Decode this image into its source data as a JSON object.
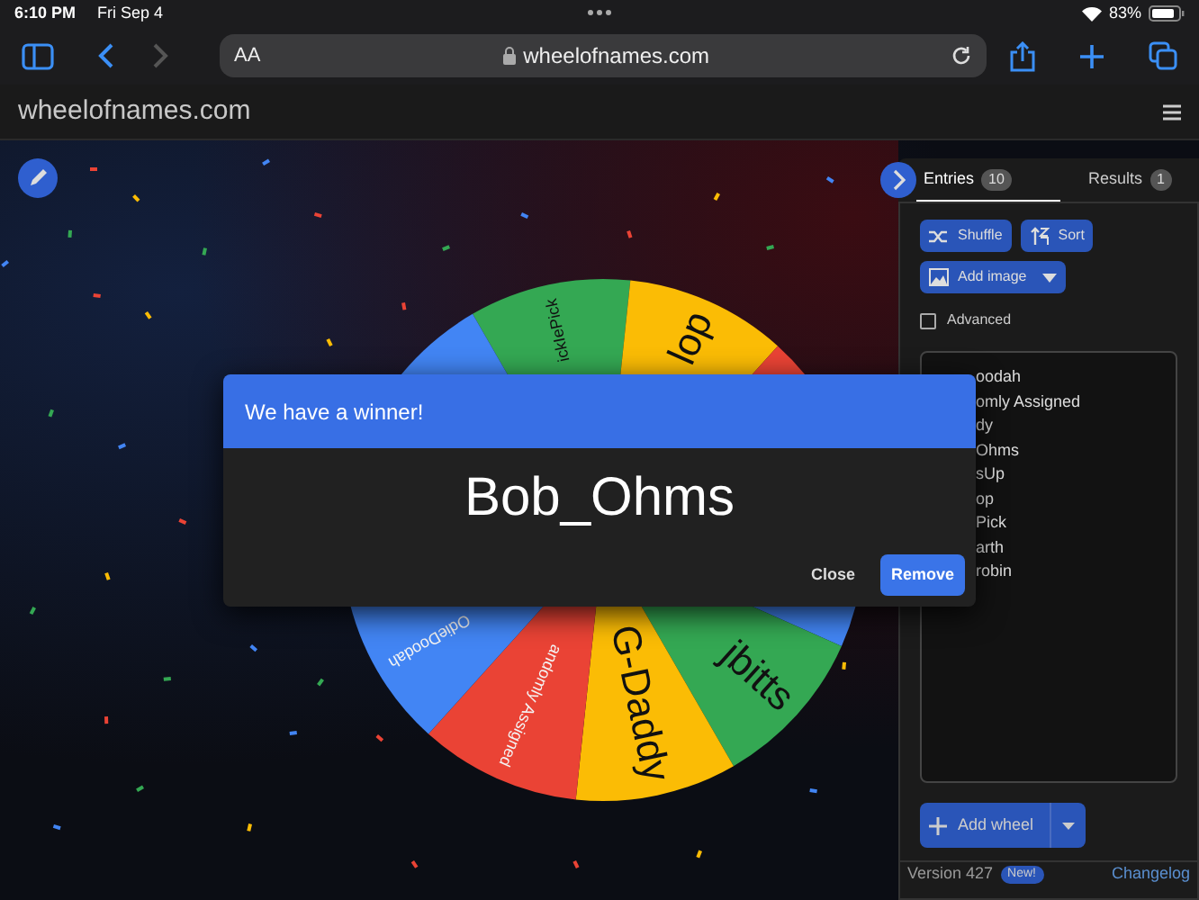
{
  "status_bar": {
    "time": "6:10 PM",
    "date": "Fri Sep 4",
    "battery": "83%"
  },
  "browser": {
    "text_size": "AA",
    "url": "wheelofnames.com"
  },
  "site_header": {
    "title": "wheelofnames.com"
  },
  "wheel": {
    "segments": [
      {
        "color": "#34a853",
        "label": "ickIePick"
      },
      {
        "color": "#fbbc05",
        "label": "lop"
      },
      {
        "color": "#ea4335"
      },
      {
        "color": "#4285f4"
      },
      {
        "color": "#34a853",
        "label": "jbitts"
      },
      {
        "color": "#fbbc05",
        "label": "G-Daddy"
      },
      {
        "color": "#ea4335",
        "label": "andomly Assigned"
      },
      {
        "color": "#4285f4",
        "label": "OdieDoodah"
      },
      {
        "color": "#4285f4"
      }
    ]
  },
  "dialog": {
    "title": "We have a winner!",
    "winner": "Bob_Ohms",
    "buttons": [
      {
        "label": "Close",
        "kind": "text"
      },
      {
        "label": "Remove",
        "kind": "primary"
      }
    ]
  },
  "panel": {
    "tabs": [
      {
        "label": "Entries",
        "count": "10",
        "selected": true
      },
      {
        "label": "Results",
        "count": "1",
        "selected": false
      }
    ],
    "buttons": [
      {
        "label": "Shuffle",
        "kind": "shuffle"
      },
      {
        "label": "Sort",
        "kind": "sort"
      },
      {
        "label": "Add image",
        "kind": "image"
      }
    ],
    "advanced": {
      "label": "Advanced",
      "checked": false
    },
    "entries": [
      "oodah",
      "omly Assigned",
      "dy",
      "Ohms",
      "sUp",
      "op",
      "Pick",
      "arth",
      "robin"
    ],
    "add_wheel": "Add wheel",
    "footer": {
      "version": "Version 427",
      "badge": "New!",
      "link": "Changelog"
    }
  }
}
